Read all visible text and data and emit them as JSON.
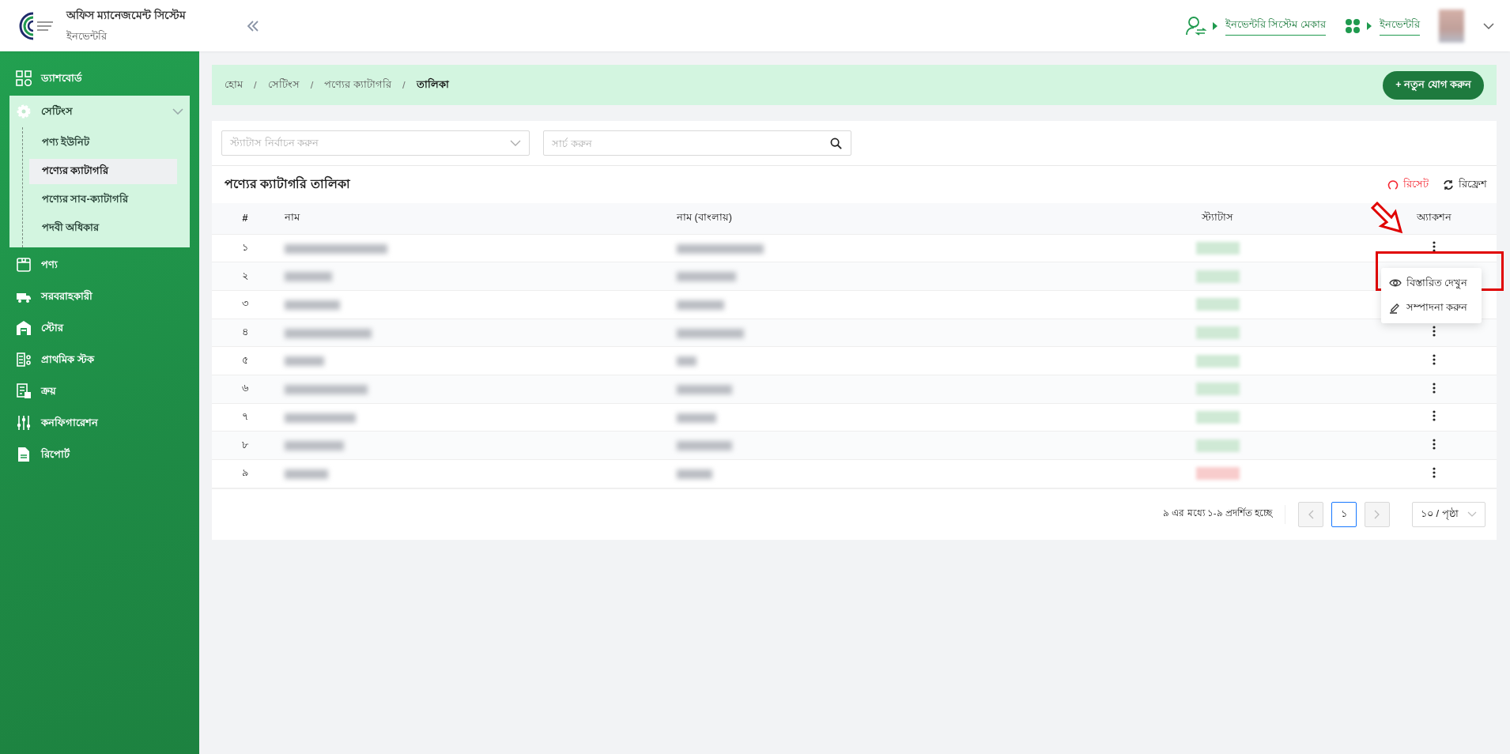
{
  "header": {
    "app_title": "অফিস ম্যানেজমেন্ট সিস্টেম",
    "app_subtitle": "ইনভেন্টরি",
    "user_role": "ইনভেন্টরি সিস্টেম মেকার",
    "module": "ইনভেন্টরি"
  },
  "sidebar": {
    "items": [
      {
        "label": "ড্যাশবোর্ড",
        "kind": "link"
      },
      {
        "label": "সেটিংস",
        "kind": "group",
        "expanded": true,
        "children": [
          {
            "label": "পণ্য ইউনিট",
            "selected": false
          },
          {
            "label": "পণ্যের ক্যাটাগরি",
            "selected": true
          },
          {
            "label": "পণ্যের সাব-ক্যাটাগরি",
            "selected": false
          },
          {
            "label": "পদবী অধিকার",
            "selected": false
          }
        ]
      },
      {
        "label": "পণ্য",
        "kind": "link"
      },
      {
        "label": "সরবরাহকারী",
        "kind": "link"
      },
      {
        "label": "স্টোর",
        "kind": "link"
      },
      {
        "label": "প্রাথমিক স্টক",
        "kind": "link"
      },
      {
        "label": "ক্রয়",
        "kind": "link"
      },
      {
        "label": "কনফিগারেশন",
        "kind": "link"
      },
      {
        "label": "রিপোর্ট",
        "kind": "link"
      }
    ]
  },
  "breadcrumb": [
    {
      "label": "হোম",
      "current": false
    },
    {
      "separator": "/",
      "label": "সেটিংস",
      "current": false
    },
    {
      "separator": "/",
      "label": "পণ্যের ক্যাটাগরি",
      "current": false
    },
    {
      "separator": "/",
      "label": "তালিকা",
      "current": true
    }
  ],
  "add_button": "+ নতুন যোগ করুন",
  "filters": {
    "status_placeholder": "স্ট্যাটাস নির্বাচন করুন",
    "search_placeholder": "সার্চ করুন"
  },
  "table": {
    "title": "পণ্যের ক্যাটাগরি তালিকা",
    "reset": "রিসেট",
    "refresh": "রিফ্রেশ",
    "columns": [
      "#",
      "নাম",
      "নাম (বাংলায়)",
      "স্ট্যাটাস",
      "অ্যাকশন"
    ],
    "rows": [
      {
        "number": "১",
        "color": "#cfe9d5"
      },
      {
        "number": "২",
        "color": "#cfe9d5",
        "menu_covers_action": true
      },
      {
        "number": "৩",
        "color": "#cfe9d5",
        "menu_covers_action": true
      },
      {
        "number": "৪",
        "color": "#cfe9d5"
      },
      {
        "number": "৫",
        "color": "#cfe9d5"
      },
      {
        "number": "৬",
        "color": "#cfe9d5"
      },
      {
        "number": "৭",
        "color": "#cfe9d5"
      },
      {
        "number": "৮",
        "color": "#cfe9d5"
      },
      {
        "number": "৯",
        "color": "#f8cccc"
      }
    ]
  },
  "action_menu": {
    "items": [
      {
        "label": "বিস্তারিত দেখুন"
      },
      {
        "label": "সম্পাদনা করুন"
      }
    ]
  },
  "pagination": {
    "summary": "৯ এর মধ্যে ১-৯ প্রদর্শিত হচ্ছে",
    "prev_disabled": true,
    "next_disabled": true,
    "pages": [
      {
        "label": "১",
        "selected": true
      }
    ],
    "page_size": "১০ / পৃষ্ঠা"
  }
}
